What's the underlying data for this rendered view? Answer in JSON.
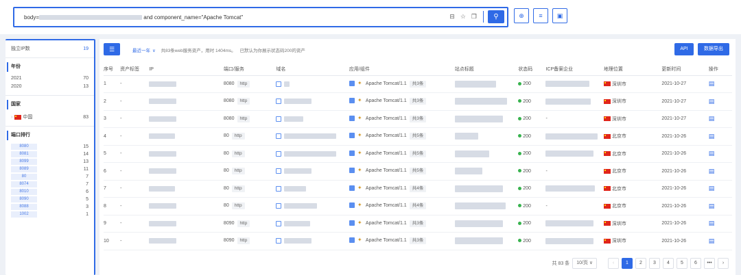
{
  "search": {
    "prefix": "body=",
    "suffix": " and component_name=\"Apache Tomcat\""
  },
  "sidebar": {
    "independent": {
      "label": "独立IP数",
      "count": "19"
    },
    "year": {
      "title": "年份",
      "items": [
        {
          "label": "2021",
          "count": "70"
        },
        {
          "label": "2020",
          "count": "13"
        }
      ]
    },
    "country": {
      "title": "国家",
      "items": [
        {
          "label": "中国",
          "count": "83"
        }
      ]
    },
    "ports": {
      "title": "端口排行",
      "items": [
        {
          "label": "8080",
          "count": "15"
        },
        {
          "label": "8081",
          "count": "14"
        },
        {
          "label": "8099",
          "count": "13"
        },
        {
          "label": "8089",
          "count": "11"
        },
        {
          "label": "80",
          "count": "7"
        },
        {
          "label": "8074",
          "count": "7"
        },
        {
          "label": "8010",
          "count": "6"
        },
        {
          "label": "8090",
          "count": "5"
        },
        {
          "label": "8088",
          "count": "3"
        },
        {
          "label": "1002",
          "count": "1"
        }
      ]
    }
  },
  "toolbar": {
    "range_label": "最近一年",
    "info_a": "共83条web服务资产，用时 1404ms。",
    "info_b": "已默认为你展示状态码200的资产",
    "api_label": "API",
    "export_label": "数据导出"
  },
  "table": {
    "headers": [
      "序号",
      "资产标签",
      "IP",
      "端口/服务",
      "域名",
      "应用/组件",
      "站点标题",
      "状态码",
      "ICP备案企业",
      "地理位置",
      "更新时间",
      "操作"
    ],
    "rows": [
      {
        "no": "1",
        "tag": "-",
        "port": "8080",
        "svc": "http",
        "app": "Apache Tomcat/1.1",
        "more": "共3条",
        "status": "200",
        "icp": "",
        "loc": "深圳市",
        "date": "2021-10-27"
      },
      {
        "no": "2",
        "tag": "-",
        "port": "8080",
        "svc": "http",
        "app": "Apache Tomcat/1.1",
        "more": "共3条",
        "status": "200",
        "icp": "",
        "loc": "深圳市",
        "date": "2021-10-27"
      },
      {
        "no": "3",
        "tag": "-",
        "port": "8080",
        "svc": "http",
        "app": "Apache Tomcat/1.1",
        "more": "共3条",
        "status": "200",
        "icp": "-",
        "loc": "深圳市",
        "date": "2021-10-27"
      },
      {
        "no": "4",
        "tag": "-",
        "port": "80",
        "svc": "http",
        "app": "Apache Tomcat/1.1",
        "more": "共5条",
        "status": "200",
        "icp": "",
        "loc": "北京市",
        "date": "2021-10-26"
      },
      {
        "no": "5",
        "tag": "-",
        "port": "80",
        "svc": "http",
        "app": "Apache Tomcat/1.1",
        "more": "共5条",
        "status": "200",
        "icp": "",
        "loc": "北京市",
        "date": "2021-10-26"
      },
      {
        "no": "6",
        "tag": "-",
        "port": "80",
        "svc": "http",
        "app": "Apache Tomcat/1.1",
        "more": "共5条",
        "status": "200",
        "icp": "-",
        "loc": "北京市",
        "date": "2021-10-26"
      },
      {
        "no": "7",
        "tag": "-",
        "port": "80",
        "svc": "http",
        "app": "Apache Tomcat/1.1",
        "more": "共4条",
        "status": "200",
        "icp": "",
        "loc": "北京市",
        "date": "2021-10-26"
      },
      {
        "no": "8",
        "tag": "-",
        "port": "80",
        "svc": "http",
        "app": "Apache Tomcat/1.1",
        "more": "共4条",
        "status": "200",
        "icp": "-",
        "loc": "北京市",
        "date": "2021-10-26"
      },
      {
        "no": "9",
        "tag": "-",
        "port": "8090",
        "svc": "http",
        "app": "Apache Tomcat/1.1",
        "more": "共3条",
        "status": "200",
        "icp": "",
        "loc": "深圳市",
        "date": "2021-10-26"
      },
      {
        "no": "10",
        "tag": "-",
        "port": "8090",
        "svc": "http",
        "app": "Apache Tomcat/1.1",
        "more": "共3条",
        "status": "200",
        "icp": "",
        "loc": "深圳市",
        "date": "2021-10-26"
      }
    ]
  },
  "pager": {
    "total": "共 83 条",
    "per_page": "10/页",
    "pages": [
      "1",
      "2",
      "3",
      "4",
      "5",
      "6",
      "•••"
    ]
  }
}
